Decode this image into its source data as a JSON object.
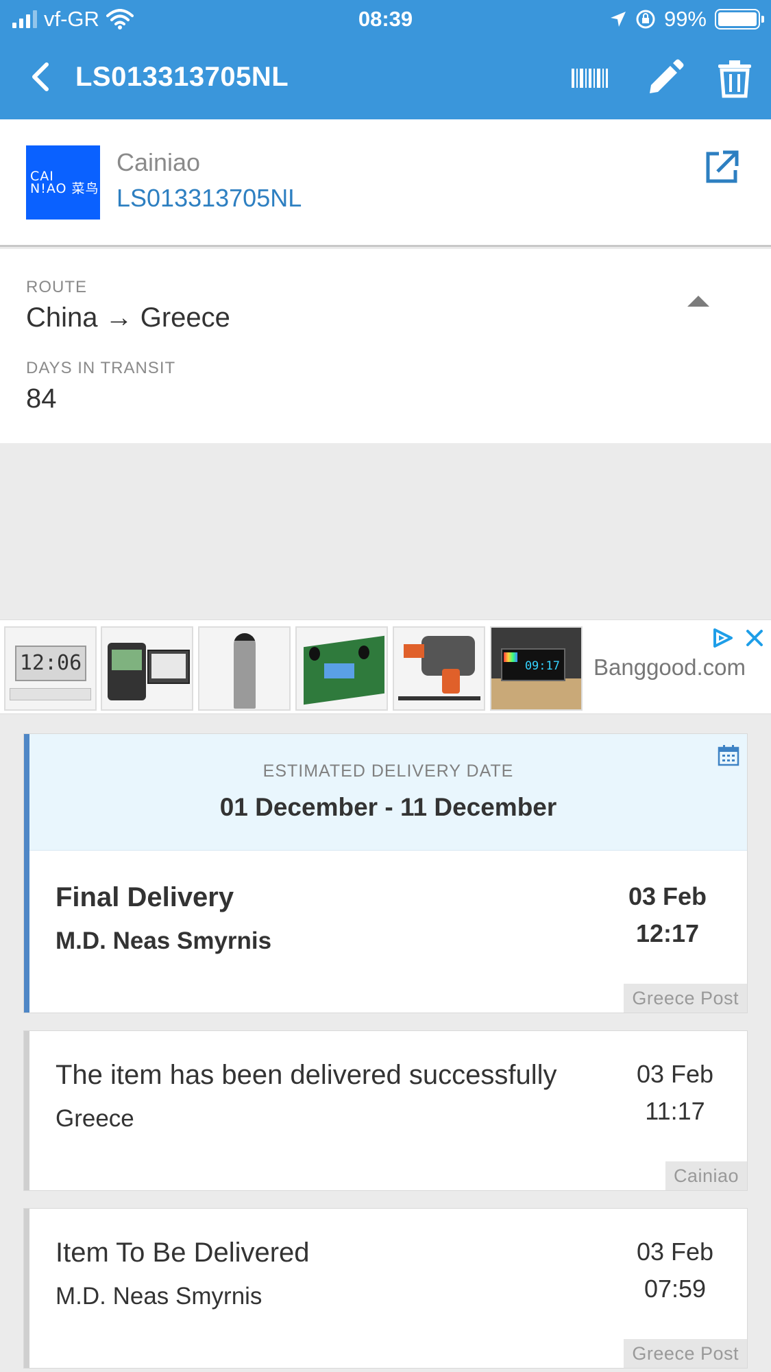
{
  "status_bar": {
    "carrier": "vf-GR",
    "time": "08:39",
    "battery": "99%"
  },
  "nav": {
    "title": "LS013313705NL"
  },
  "carrier": {
    "logo_text_1": "CAI",
    "logo_text_2": "N!AO 菜鸟",
    "name": "Cainiao",
    "tracking_number": "LS013313705NL"
  },
  "route": {
    "route_label": "ROUTE",
    "route_value": "China → Greece",
    "transit_label": "DAYS IN TRANSIT",
    "transit_value": "84"
  },
  "ad": {
    "brand": "Banggood.com",
    "thumb_clock": "12:06",
    "thumb_matrix": "09:17"
  },
  "estimate": {
    "label": "ESTIMATED DELIVERY DATE",
    "value": "01 December - 11 December"
  },
  "events": [
    {
      "title": "Final Delivery",
      "location": "M.D. Neas Smyrnis",
      "date": "03 Feb",
      "time": "12:17",
      "source": "Greece Post"
    },
    {
      "title": "The item has been delivered successfully",
      "location": "Greece",
      "date": "03 Feb",
      "time": "11:17",
      "source": "Cainiao"
    },
    {
      "title": "Item To Be Delivered",
      "location": "M.D. Neas Smyrnis",
      "date": "03 Feb",
      "time": "07:59",
      "source": "Greece Post"
    }
  ],
  "colors": {
    "header": "#3a96db",
    "accent_link": "#2d7fc1",
    "logo_bg": "#0a61ff",
    "estimate_bg": "#e9f6fd",
    "active_bar": "#4f87c6"
  }
}
